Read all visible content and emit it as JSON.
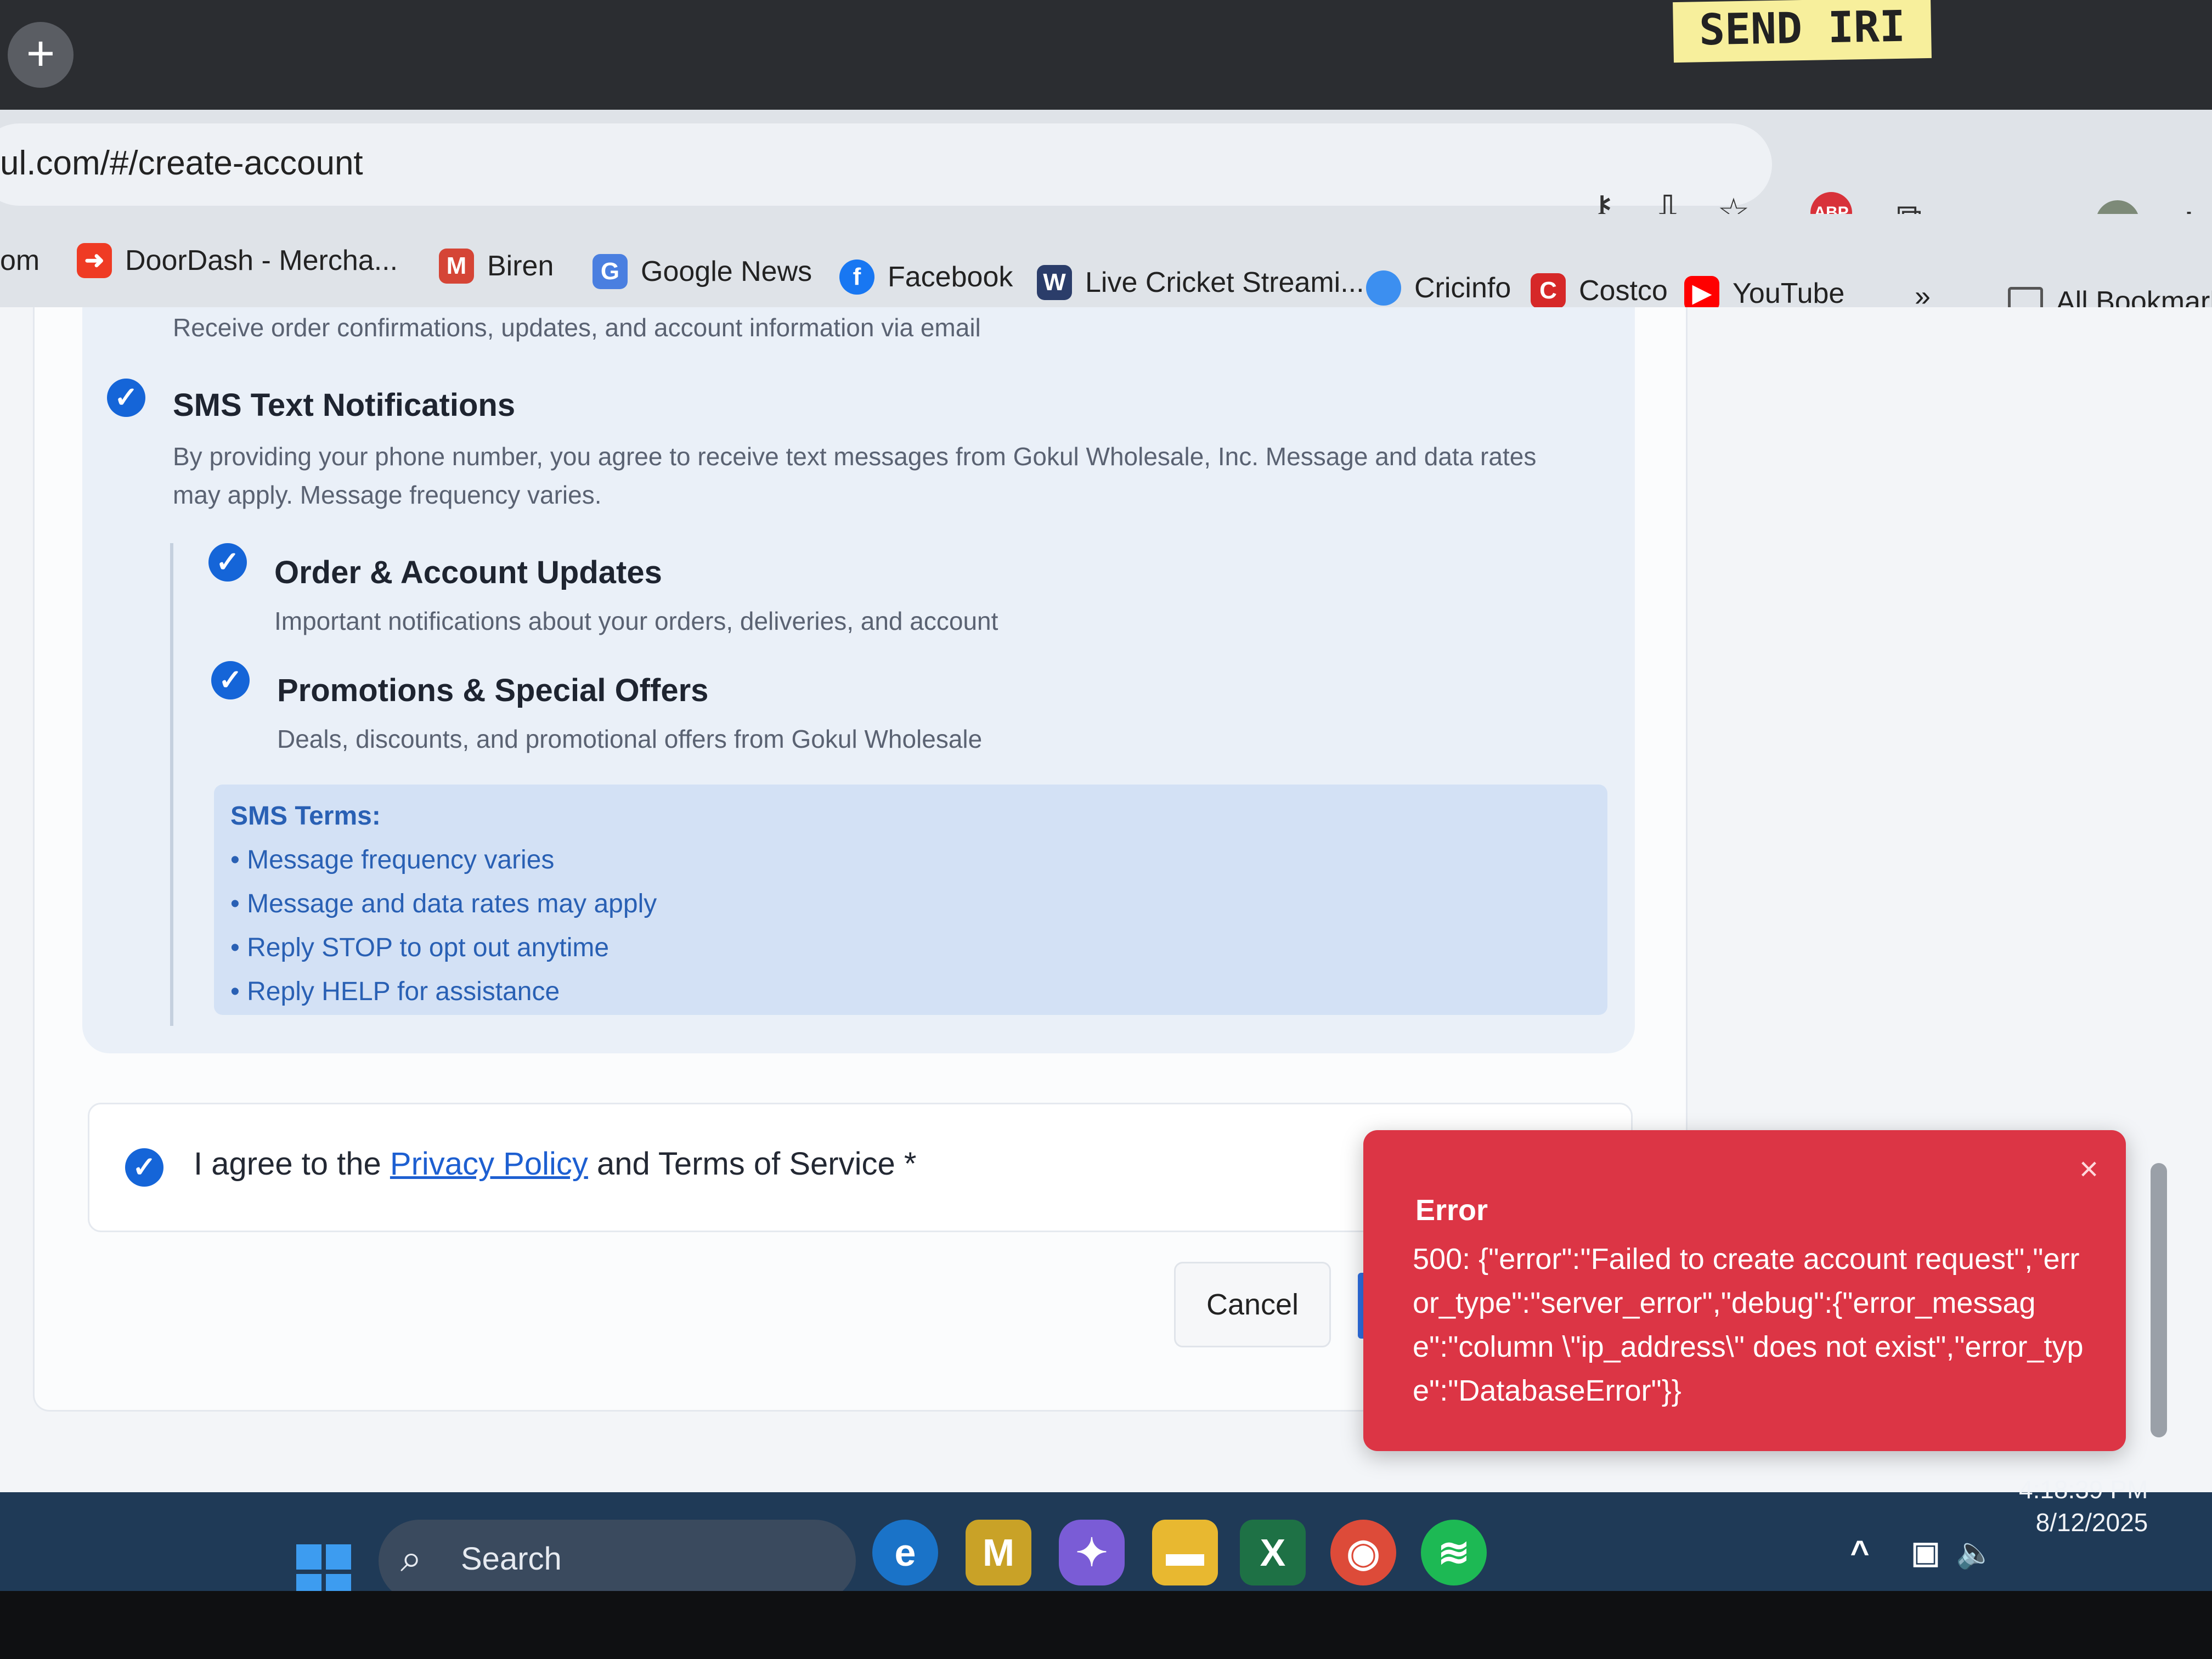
{
  "window": {
    "new_tab": "+",
    "sticky_note": "SEND IRI",
    "min": "–",
    "close": "✕"
  },
  "address": {
    "url": "ul.com/#/create-account"
  },
  "bookmarks": [
    {
      "label": "om"
    },
    {
      "label": "DoorDash - Mercha..."
    },
    {
      "label": "Biren"
    },
    {
      "label": "Google News"
    },
    {
      "label": "Facebook"
    },
    {
      "label": "Live Cricket Streami..."
    },
    {
      "label": "Cricinfo"
    },
    {
      "label": "Costco"
    },
    {
      "label": "YouTube"
    },
    {
      "label": "»"
    },
    {
      "label": "All Bookmarks"
    }
  ],
  "prefs": {
    "email_desc": "Receive order confirmations, updates, and account information via email",
    "sms_title": "SMS Text Notifications",
    "sms_desc_1": "By providing your phone number, you agree to receive text messages from Gokul Wholesale, Inc. Message and data rates",
    "sms_desc_2": "may apply. Message frequency varies.",
    "order_title": "Order & Account Updates",
    "order_desc": "Important notifications about your orders, deliveries, and account",
    "promo_title": "Promotions & Special Offers",
    "promo_desc": "Deals, discounts, and promotional offers from Gokul Wholesale",
    "terms_heading": "SMS Terms:",
    "terms": [
      "• Message frequency varies",
      "• Message and data rates may apply",
      "• Reply STOP to opt out anytime",
      "• Reply HELP for assistance"
    ]
  },
  "agree": {
    "prefix": "I agree to the ",
    "link": "Privacy Policy",
    "suffix": " and Terms of Service *"
  },
  "buttons": {
    "cancel": "Cancel"
  },
  "toast": {
    "title": "Error",
    "message": "500: {\"error\":\"Failed to create account request\",\"error_type\":\"server_error\",\"debug\":{\"error_message\":\"column \\\"ip_address\\\" does not exist\",\"error_type\":\"DatabaseError\"}}",
    "close": "×"
  },
  "taskbar": {
    "search": "Search",
    "time": "4:18:39 PM",
    "date": "8/12/2025"
  }
}
